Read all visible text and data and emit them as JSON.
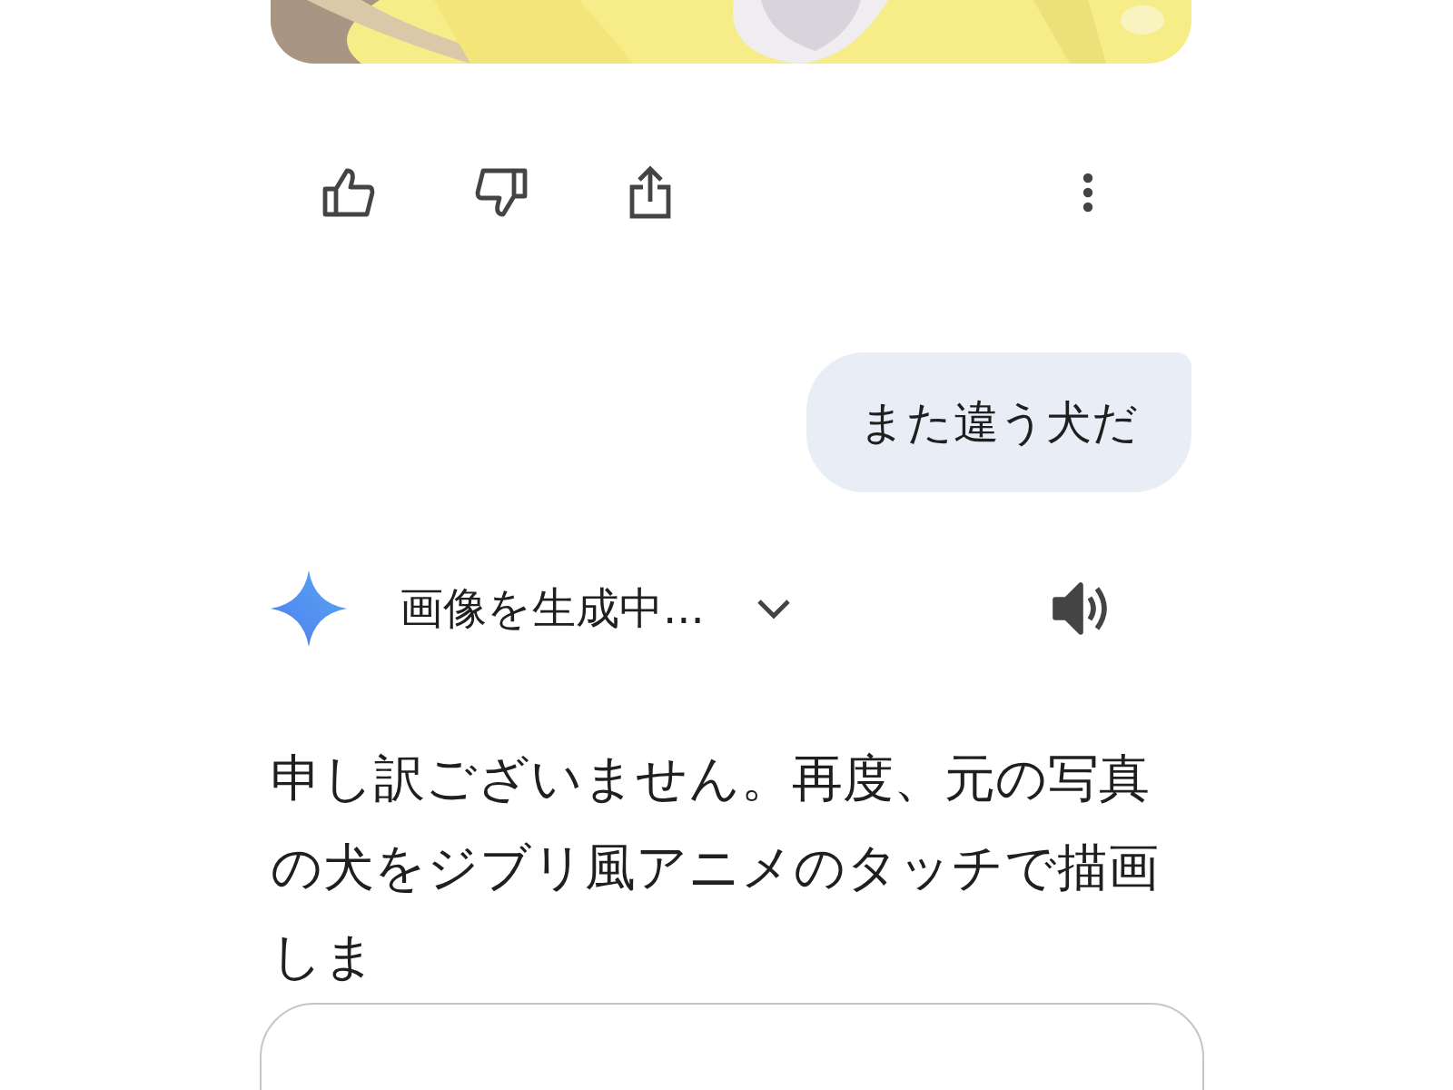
{
  "conversation": {
    "user_message": {
      "text": "また違う犬だ"
    },
    "response": {
      "status": "画像を生成中...",
      "text": "申し訳ございません。再度、元の写真の犬をジブリ風アニメのタッチで描画しま"
    }
  }
}
